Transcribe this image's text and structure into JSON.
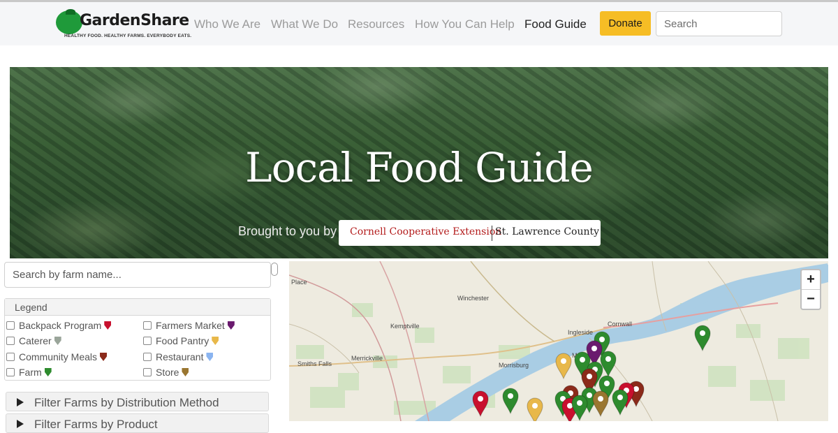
{
  "header": {
    "logo_name": "GardenShare",
    "logo_tagline": "HEALTHY FOOD. HEALTHY FARMS. EVERYBODY EATS.",
    "nav": [
      {
        "label": "Who We Are"
      },
      {
        "label": "What We Do"
      },
      {
        "label": "Resources"
      },
      {
        "label": "How You Can Help"
      },
      {
        "label": "Food Guide"
      }
    ],
    "donate_label": "Donate",
    "search_placeholder": "Search"
  },
  "hero": {
    "title": "Local Food Guide",
    "brought_by": "Brought to you by",
    "partner_left": "Cornell Cooperative Extension",
    "partner_right": "St. Lawrence County"
  },
  "filters": {
    "search_placeholder": "Search by farm name...",
    "legend_title": "Legend",
    "legend": [
      {
        "label": "Backpack Program",
        "color": "#c8102e"
      },
      {
        "label": "Farmers Market",
        "color": "#6a1a6e"
      },
      {
        "label": "Caterer",
        "color": "#9aa59a"
      },
      {
        "label": "Food Pantry",
        "color": "#e8b84a"
      },
      {
        "label": "Community Meals",
        "color": "#8b2a1a"
      },
      {
        "label": "Restaurant",
        "color": "#8ab4f0"
      },
      {
        "label": "Farm",
        "color": "#2e8b2e"
      },
      {
        "label": "Store",
        "color": "#9a7630"
      }
    ],
    "accordion": [
      {
        "label": "Filter Farms by Distribution Method"
      },
      {
        "label": "Filter Farms by Product"
      }
    ]
  },
  "map": {
    "labels": [
      "Place",
      "Winchester",
      "Kemptville",
      "Ingleside",
      "Cornwall",
      "Merrickville",
      "Smiths Falls",
      "Morrisburg",
      "Massena"
    ],
    "zoom_in": "+",
    "zoom_out": "−",
    "marker_colors": {
      "farm": "#2e8b2e",
      "pantry": "#e8b84a",
      "market": "#6a1a6e",
      "meals": "#8b2a1a",
      "backpack": "#c8102e",
      "store": "#9a7630"
    }
  }
}
